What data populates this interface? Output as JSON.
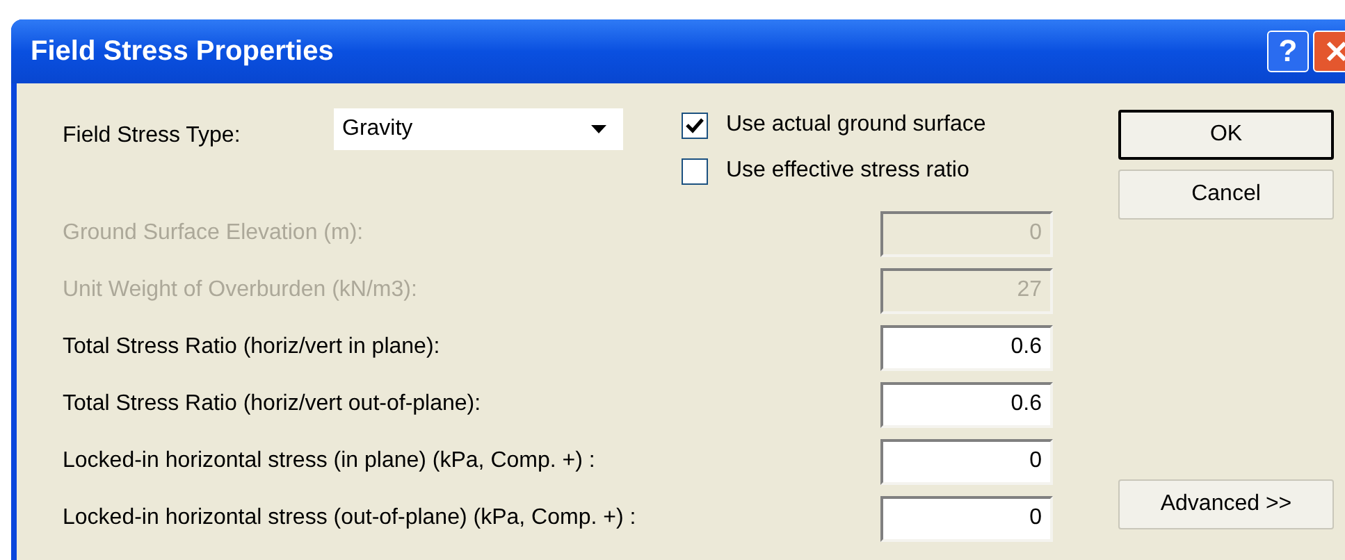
{
  "window": {
    "title": "Field Stress Properties",
    "help_glyph": "?"
  },
  "field_stress_type": {
    "label": "Field Stress Type:",
    "value": "Gravity"
  },
  "checkboxes": [
    {
      "label": "Use actual ground surface",
      "checked": true
    },
    {
      "label": "Use effective stress ratio",
      "checked": false
    }
  ],
  "fields": [
    {
      "label": "Ground Surface Elevation (m):",
      "value": "0",
      "disabled": true
    },
    {
      "label": "Unit Weight of Overburden (kN/m3):",
      "value": "27",
      "disabled": true
    },
    {
      "label": "Total Stress Ratio (horiz/vert in plane):",
      "value": "0.6",
      "disabled": false
    },
    {
      "label": "Total Stress Ratio (horiz/vert out-of-plane):",
      "value": "0.6",
      "disabled": false
    },
    {
      "label": "Locked-in horizontal stress (in plane) (kPa, Comp. +) :",
      "value": "0",
      "disabled": false
    },
    {
      "label": "Locked-in horizontal stress (out-of-plane) (kPa, Comp. +) :",
      "value": "0",
      "disabled": false
    }
  ],
  "buttons": [
    {
      "label": "OK",
      "default": true
    },
    {
      "label": "Cancel",
      "default": false
    }
  ],
  "advanced_button": {
    "label": "Advanced >>"
  }
}
